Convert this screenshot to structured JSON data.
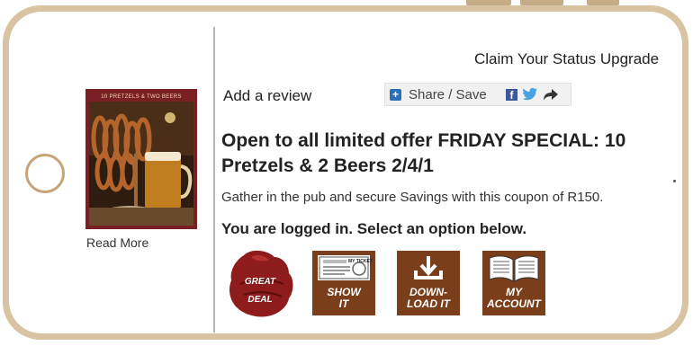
{
  "header": {
    "claim_link": "Claim Your Status Upgrade"
  },
  "offer_image": {
    "caption": "10 PRETZELS & TWO BEERS",
    "read_more": "Read More"
  },
  "actions": {
    "add_review": "Add a review",
    "share_label": "Share / Save"
  },
  "offer": {
    "title": "Open to all limited offer FRIDAY SPECIAL: 10 Pretzels & 2 Beers 2/4/1",
    "description": "Gather in the pub and secure Savings with this coupon of R150.",
    "status": "You are logged in. Select an option below."
  },
  "options": {
    "great_deal": "GREAT DEAL",
    "show_it": "SHOW IT",
    "download_it": "DOWN-LOAD IT",
    "my_account": "MY ACCOUNT",
    "ticket_text": "MY TICKET"
  },
  "colors": {
    "frame": "#d8c3a2",
    "option_bg": "#7b3e1b",
    "great_deal_red": "#8e1c1c",
    "share_blue": "#2d6fb6"
  }
}
